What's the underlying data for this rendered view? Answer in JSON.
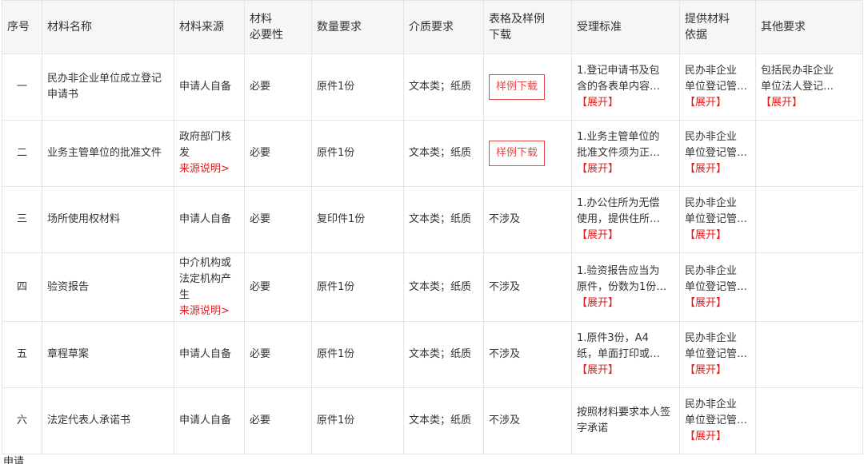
{
  "headers": [
    "序号",
    "材料名称",
    "材料来源",
    "材料必要性",
    "数量要求",
    "介质要求",
    "表格及样例下载",
    "受理标准",
    "提供材料依据",
    "其他要求"
  ],
  "header_lines": {
    "necessity": [
      "材料",
      "必要性"
    ],
    "download": [
      "表格及样例",
      "下载"
    ],
    "basis": [
      "提供材料",
      "依据"
    ]
  },
  "expand_label": "【展开】",
  "source_note_label": "来源说明>",
  "rows": [
    {
      "idx": "一",
      "name": "民办非企业单位成立登记申请书",
      "source": "申请人自备",
      "source_note": false,
      "necessity": "必要",
      "quantity": "原件1份",
      "medium": "文本类；纸质",
      "download": "样例下载",
      "download_is_button": true,
      "standard_l1": "1.登记申请书及包",
      "standard_l2": "含的各表单内容…",
      "basis_l1": "民办非企业",
      "basis_l2": "单位登记管…",
      "other_l1": "包括民办非企业",
      "other_l2": "单位法人登记…"
    },
    {
      "idx": "二",
      "name": "业务主管单位的批准文件",
      "source": "政府部门核发",
      "source_note": true,
      "necessity": "必要",
      "quantity": "原件1份",
      "medium": "文本类；纸质",
      "download": "样例下载",
      "download_is_button": true,
      "standard_l1": "1.业务主管单位的",
      "standard_l2": "批准文件须为正…",
      "basis_l1": "民办非企业",
      "basis_l2": "单位登记管…",
      "other_l1": "",
      "other_l2": ""
    },
    {
      "idx": "三",
      "name": "场所使用权材料",
      "source": "申请人自备",
      "source_note": false,
      "necessity": "必要",
      "quantity": "复印件1份",
      "medium": "文本类；纸质",
      "download": "不涉及",
      "download_is_button": false,
      "standard_l1": "1.办公住所为无偿",
      "standard_l2": "使用，提供住所…",
      "basis_l1": "民办非企业",
      "basis_l2": "单位登记管…",
      "other_l1": "",
      "other_l2": ""
    },
    {
      "idx": "四",
      "name": "验资报告",
      "source": "中介机构或法定机构产生",
      "source_note": true,
      "necessity": "必要",
      "quantity": "原件1份",
      "medium": "文本类；纸质",
      "download": "不涉及",
      "download_is_button": false,
      "standard_l1": "1.验资报告应当为",
      "standard_l2": "原件，份数为1份…",
      "basis_l1": "民办非企业",
      "basis_l2": "单位登记管…",
      "other_l1": "",
      "other_l2": ""
    },
    {
      "idx": "五",
      "name": "章程草案",
      "source": "申请人自备",
      "source_note": false,
      "necessity": "必要",
      "quantity": "原件1份",
      "medium": "文本类；纸质",
      "download": "不涉及",
      "download_is_button": false,
      "standard_l1": "1.原件3份，A4",
      "standard_l2": "纸，单面打印或…",
      "basis_l1": "民办非企业",
      "basis_l2": "单位登记管…",
      "other_l1": "",
      "other_l2": ""
    },
    {
      "idx": "六",
      "name": "法定代表人承诺书",
      "source": "申请人自备",
      "source_note": false,
      "necessity": "必要",
      "quantity": "原件1份",
      "medium": "文本类；纸质",
      "download": "不涉及",
      "download_is_button": false,
      "standard_full": "按照材料要求本人签字承诺",
      "basis_l1": "民办非企业",
      "basis_l2": "单位登记管…",
      "other_l1": "",
      "other_l2": ""
    }
  ],
  "bottom_text": "申请"
}
